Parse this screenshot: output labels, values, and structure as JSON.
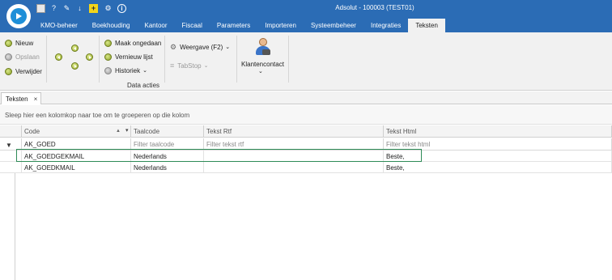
{
  "window": {
    "title": "Adsolut - 100003 (TEST01)",
    "controls": [
      "–",
      "❐",
      "✕"
    ]
  },
  "quick_access": [
    "calculator-icon",
    "help-icon",
    "tools-icon",
    "download-icon",
    "add-icon",
    "plug-icon",
    "info-icon"
  ],
  "tabs": [
    {
      "label": "KMO-beheer"
    },
    {
      "label": "Boekhouding"
    },
    {
      "label": "Kantoor"
    },
    {
      "label": "Fiscaal"
    },
    {
      "label": "Parameters"
    },
    {
      "label": "Importeren"
    },
    {
      "label": "Systeembeheer"
    },
    {
      "label": "Integraties"
    },
    {
      "label": "Teksten"
    }
  ],
  "ribbon": {
    "new_label": "Nieuw",
    "save_label": "Opslaan",
    "delete_label": "Verwijder",
    "undo_label": "Maak ongedaan",
    "refresh_label": "Vernieuw lijst",
    "history_label": "Historiek",
    "view_label": "Weergave (F2)",
    "tabstop_label": "TabStop",
    "contact_label": "Klantencontact",
    "group_label": "Data acties"
  },
  "document_tab": {
    "label": "Teksten",
    "close": "×"
  },
  "group_panel_text": "Sleep hier een kolomkop naar toe om te groeperen op die kolom",
  "grid": {
    "columns": [
      "Code",
      "Taalcode",
      "Tekst Rtf",
      "Tekst Html"
    ],
    "filters": {
      "code": "AK_GOED",
      "taalcode": "Filter taalcode",
      "rtf": "Filter tekst rtf",
      "html": "Filter tekst html"
    },
    "rows": [
      {
        "code": "AK_GOEDGEKMAIL",
        "taalcode": "Nederlands",
        "rtf": "",
        "html": "Beste,"
      },
      {
        "code": "AK_GOEDKMAIL",
        "taalcode": "Nederlands",
        "rtf": "",
        "html": "Beste,"
      }
    ]
  },
  "colors": {
    "accent": "#2b6cb5",
    "highlight": "#2e8b57"
  }
}
